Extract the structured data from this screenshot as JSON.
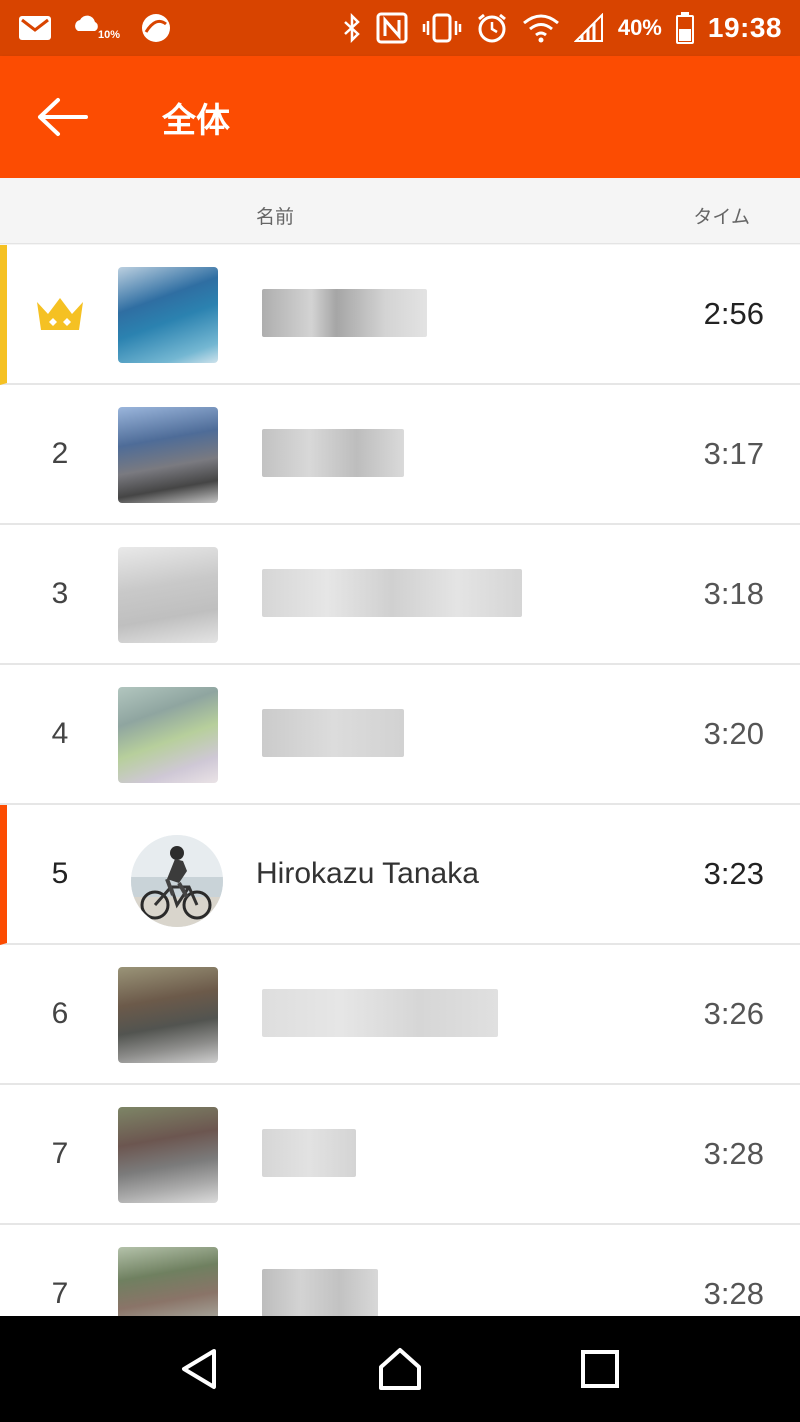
{
  "status_bar": {
    "weather_text": "10%",
    "battery_text": "40%",
    "clock": "19:38"
  },
  "app_bar": {
    "title": "全体"
  },
  "list_header": {
    "name_label": "名前",
    "time_label": "タイム"
  },
  "leaderboard": [
    {
      "rank": "",
      "time": "2:56",
      "highlight": "first-place"
    },
    {
      "rank": "2",
      "time": "3:17"
    },
    {
      "rank": "3",
      "time": "3:18"
    },
    {
      "rank": "4",
      "time": "3:20"
    },
    {
      "rank": "5",
      "name": "Hirokazu Tanaka",
      "time": "3:23",
      "highlight": "current-user"
    },
    {
      "rank": "6",
      "time": "3:26"
    },
    {
      "rank": "7",
      "time": "3:28"
    },
    {
      "rank": "7",
      "time": "3:28"
    }
  ],
  "colors": {
    "app_bar": "#fc4c02",
    "status_bar": "#d84400",
    "first_place_accent": "#f5c123",
    "current_user_accent": "#fc4c02"
  },
  "icons": {
    "status_left": [
      "gmail-icon",
      "weather-icon",
      "app-icon"
    ],
    "status_right": [
      "bluetooth-icon",
      "nfc-icon",
      "vibrate-icon",
      "alarm-icon",
      "wifi-icon",
      "signal-icon",
      "battery-icon"
    ],
    "nav": [
      "back-triangle-icon",
      "home-icon",
      "recents-icon"
    ]
  }
}
